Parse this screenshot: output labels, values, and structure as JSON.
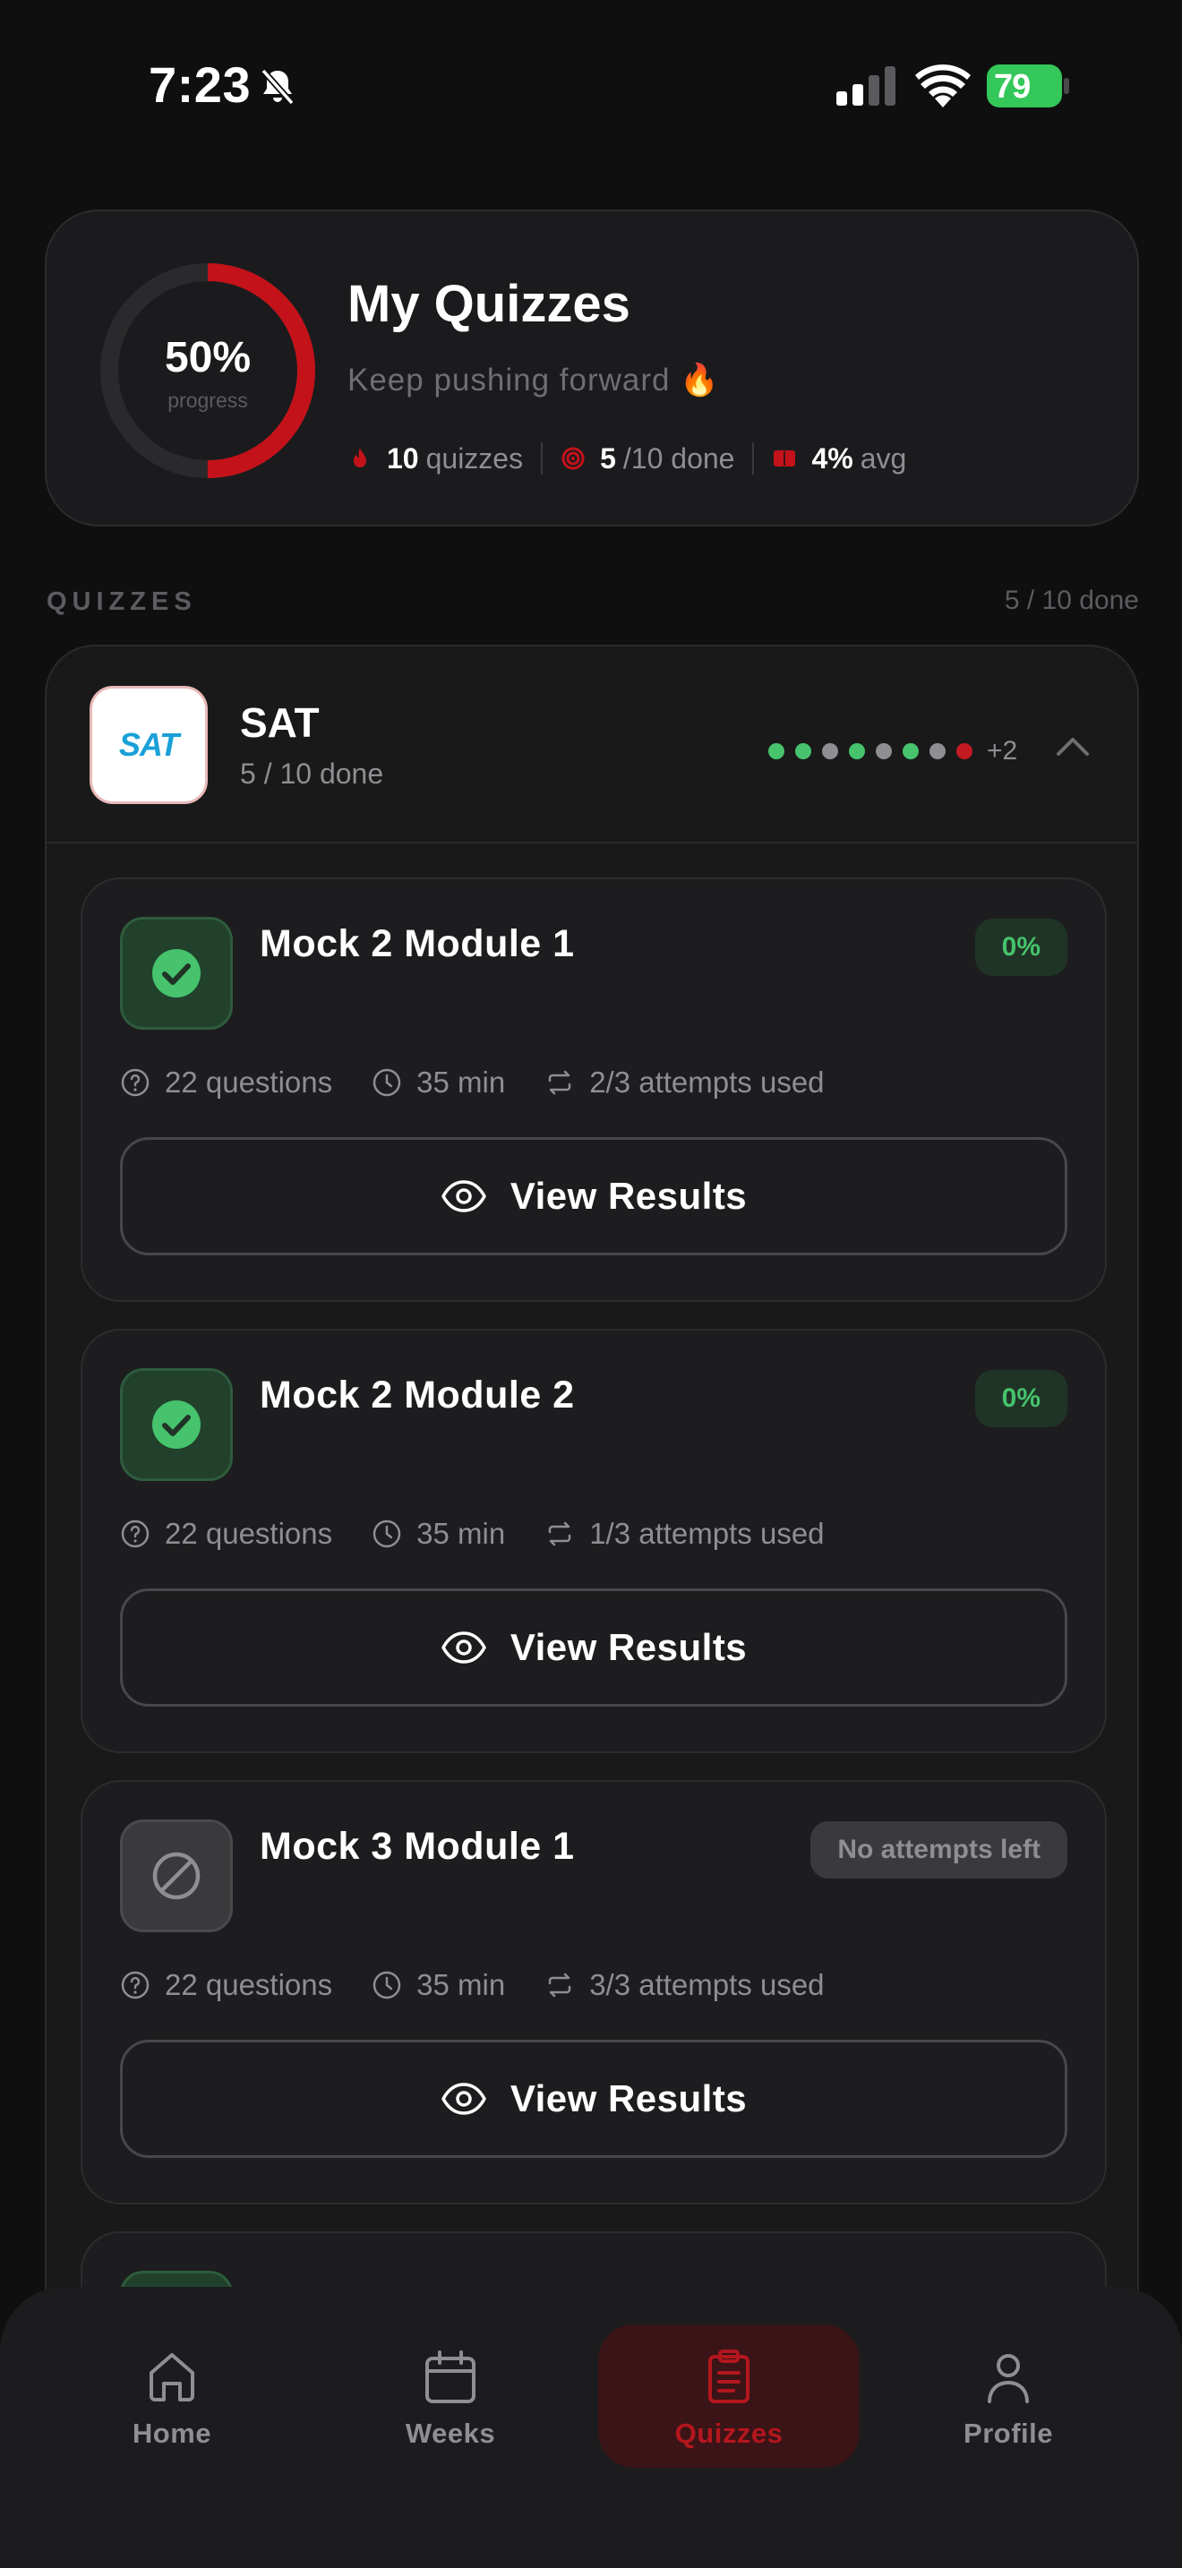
{
  "status_bar": {
    "time": "7:23",
    "battery": "79"
  },
  "summary": {
    "progress_value": 0.5,
    "progress_pct": "50%",
    "progress_label": "progress",
    "title": "My Quizzes",
    "subtitle": "Keep pushing forward 🔥",
    "stats": [
      {
        "icon": "flame-icon",
        "value": "10",
        "label": "quizzes"
      },
      {
        "icon": "target-icon",
        "value": "5",
        "label": "/10 done"
      },
      {
        "icon": "book-icon",
        "value": "4%",
        "label": "avg"
      }
    ]
  },
  "section": {
    "title": "QUIZZES",
    "count": "5 / 10 done"
  },
  "course": {
    "logo_text": "SAT",
    "name": "SAT",
    "progress": "5 / 10 done",
    "dot_colors": [
      "#46c36c",
      "#46c36c",
      "#8e8e93",
      "#46c36c",
      "#8e8e93",
      "#46c36c",
      "#8e8e93",
      "#c41a22"
    ],
    "dots_more": "+2"
  },
  "quizzes": [
    {
      "title": "Mock 2 Module 1",
      "status": "done",
      "badge": "0%",
      "questions": "22 questions",
      "duration": "35 min",
      "attempts": "2/3 attempts used",
      "button": "View Results"
    },
    {
      "title": "Mock 2 Module 2",
      "status": "done",
      "badge": "0%",
      "questions": "22 questions",
      "duration": "35 min",
      "attempts": "1/3 attempts used",
      "button": "View Results"
    },
    {
      "title": "Mock 3 Module 1",
      "status": "blocked",
      "badge": "No attempts left",
      "questions": "22 questions",
      "duration": "35 min",
      "attempts": "3/3 attempts used",
      "button": "View Results"
    }
  ],
  "nav": [
    {
      "label": "Home",
      "icon": "home-icon",
      "active": false
    },
    {
      "label": "Weeks",
      "icon": "calendar-icon",
      "active": false
    },
    {
      "label": "Quizzes",
      "icon": "clipboard-icon",
      "active": true
    },
    {
      "label": "Profile",
      "icon": "user-icon",
      "active": false
    }
  ],
  "colors": {
    "accent": "#b3161e",
    "success": "#46c36c",
    "background": "#0f0f10"
  }
}
